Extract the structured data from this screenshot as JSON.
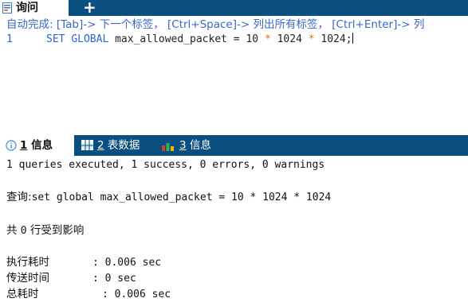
{
  "editor": {
    "tab_label": "询问",
    "add_tab_label": "+",
    "autocomplete_hint": "自动完成: [Tab]-> 下一个标签， [Ctrl+Space]-> 列出所有标签， [Ctrl+Enter]-> 列",
    "line_number": "1",
    "code": {
      "kw1": "SET",
      "kw2": "GLOBAL",
      "ident": "max_allowed_packet = 10",
      "op1": "*",
      "n2": "1024",
      "op2": "*",
      "n3": "1024;"
    }
  },
  "results_tabs": [
    {
      "number": "1",
      "label": "信息",
      "active": true,
      "icon": "info-icon"
    },
    {
      "number": "2",
      "label": "表数据",
      "active": false,
      "icon": "table-grid-icon"
    },
    {
      "number": "3",
      "label": "信息",
      "active": false,
      "icon": "bar-chart-icon"
    }
  ],
  "messages": {
    "summary": "1 queries executed, 1 success, 0 errors, 0 warnings",
    "query_label": "查询:",
    "query_text": "set global max_allowed_packet = 10 * 1024 * 1024",
    "affected_prefix": "共",
    "affected_count": "0",
    "affected_suffix": "行受到影响",
    "exec_time_label": "执行耗时",
    "exec_time_value": ": 0.006 sec",
    "transfer_time_label": "传送时间",
    "transfer_time_value": ": 0 sec",
    "total_time_label": "总耗时",
    "total_time_value": ": 0.006 sec"
  },
  "colors": {
    "tabbar_bg": "#0a4f7f",
    "keyword": "#2b63d6",
    "operator": "#e07000",
    "hint": "#3b67c9"
  }
}
